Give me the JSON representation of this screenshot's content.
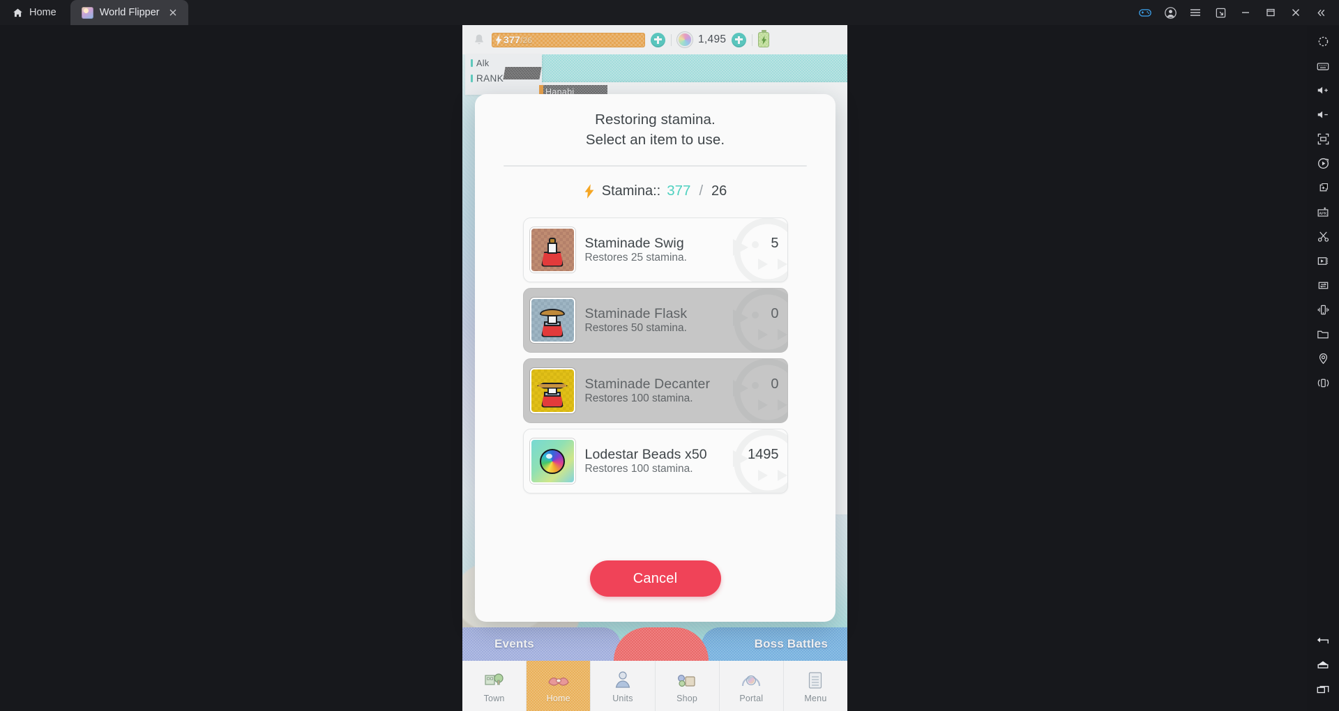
{
  "window": {
    "home_tab_label": "Home",
    "tab_label": "World Flipper",
    "tab_close_icon": "close-icon",
    "controls": [
      {
        "name": "gamepad-icon",
        "label": "Gamepad"
      },
      {
        "name": "account-icon",
        "label": "Account"
      },
      {
        "name": "menu-icon",
        "label": "Menu"
      },
      {
        "name": "resize-icon",
        "label": "Resize"
      },
      {
        "name": "minimize-icon",
        "label": "Minimize"
      },
      {
        "name": "maximize-icon",
        "label": "Maximize"
      },
      {
        "name": "close-icon",
        "label": "Close"
      },
      {
        "name": "collapse-icon",
        "label": "Collapse sidebar"
      }
    ]
  },
  "sidebar": {
    "items": [
      {
        "name": "fullscreen-gear-icon",
        "label": "Operation settings"
      },
      {
        "name": "keyboard-icon",
        "label": "Keyboard mapping"
      },
      {
        "name": "volume-up-icon",
        "label": "Volume up"
      },
      {
        "name": "volume-down-icon",
        "label": "Volume down"
      },
      {
        "name": "fullscreen-icon",
        "label": "Fullscreen"
      },
      {
        "name": "macro-record-icon",
        "label": "Macro recorder"
      },
      {
        "name": "multi-instance-icon",
        "label": "Multi-instance"
      },
      {
        "name": "install-apk-icon",
        "label": "Install APK"
      },
      {
        "name": "scissors-icon",
        "label": "Screenshot"
      },
      {
        "name": "screen-record-icon",
        "label": "Screen record"
      },
      {
        "name": "copy-paste-icon",
        "label": "Copy to clipboard"
      },
      {
        "name": "shake-icon",
        "label": "Shake"
      },
      {
        "name": "folder-icon",
        "label": "Shared folder"
      },
      {
        "name": "location-icon",
        "label": "Location"
      },
      {
        "name": "rotate-icon",
        "label": "Rotate"
      }
    ],
    "nav": [
      {
        "name": "back-icon",
        "label": "Back"
      },
      {
        "name": "home-icon",
        "label": "Home"
      },
      {
        "name": "recents-icon",
        "label": "Recent apps"
      }
    ]
  },
  "game": {
    "hud": {
      "bell_icon": "bell-icon",
      "stamina_current": "377",
      "stamina_separator": "/",
      "stamina_max": "26",
      "stamina_add_icon": "plus-icon",
      "orb_icon": "lodestar-orb-icon",
      "orb_count": "1,495",
      "orb_add_icon": "plus-icon",
      "battery_icon": "battery-icon"
    },
    "player": {
      "name_label": "Alk",
      "rank_label": "RANK",
      "display_name": "Hanabi"
    },
    "banners": {
      "left": "Events",
      "right": "Boss Battles"
    },
    "bottom_nav": [
      {
        "label": "Town",
        "icon": "town-icon",
        "active": false
      },
      {
        "label": "Home",
        "icon": "home-icon",
        "active": true
      },
      {
        "label": "Units",
        "icon": "units-icon",
        "active": false
      },
      {
        "label": "Shop",
        "icon": "shop-icon",
        "active": false
      },
      {
        "label": "Portal",
        "icon": "portal-icon",
        "active": false
      },
      {
        "label": "Menu",
        "icon": "menu-icon",
        "active": false
      }
    ]
  },
  "modal": {
    "title_line1": "Restoring stamina.",
    "title_line2": "Select an item to use.",
    "stamina_bolt_icon": "bolt-icon",
    "stamina_label": "Stamina::",
    "stamina_current": "377",
    "stamina_slash": "/",
    "stamina_max": "26",
    "items": [
      {
        "name": "Staminade Swig",
        "description": "Restores 25 stamina.",
        "quantity": "5",
        "icon": "staminade-swig-icon",
        "enabled": true
      },
      {
        "name": "Staminade Flask",
        "description": "Restores 50 stamina.",
        "quantity": "0",
        "icon": "staminade-flask-icon",
        "enabled": false
      },
      {
        "name": "Staminade Decanter",
        "description": "Restores 100 stamina.",
        "quantity": "0",
        "icon": "staminade-decanter-icon",
        "enabled": false
      },
      {
        "name": "Lodestar Beads x50",
        "description": "Restores 100 stamina.",
        "quantity": "1495",
        "icon": "lodestar-beads-icon",
        "enabled": true
      }
    ],
    "cancel_label": "Cancel",
    "accent_color": "#f04358",
    "stamina_value_color": "#4fd1c0"
  }
}
